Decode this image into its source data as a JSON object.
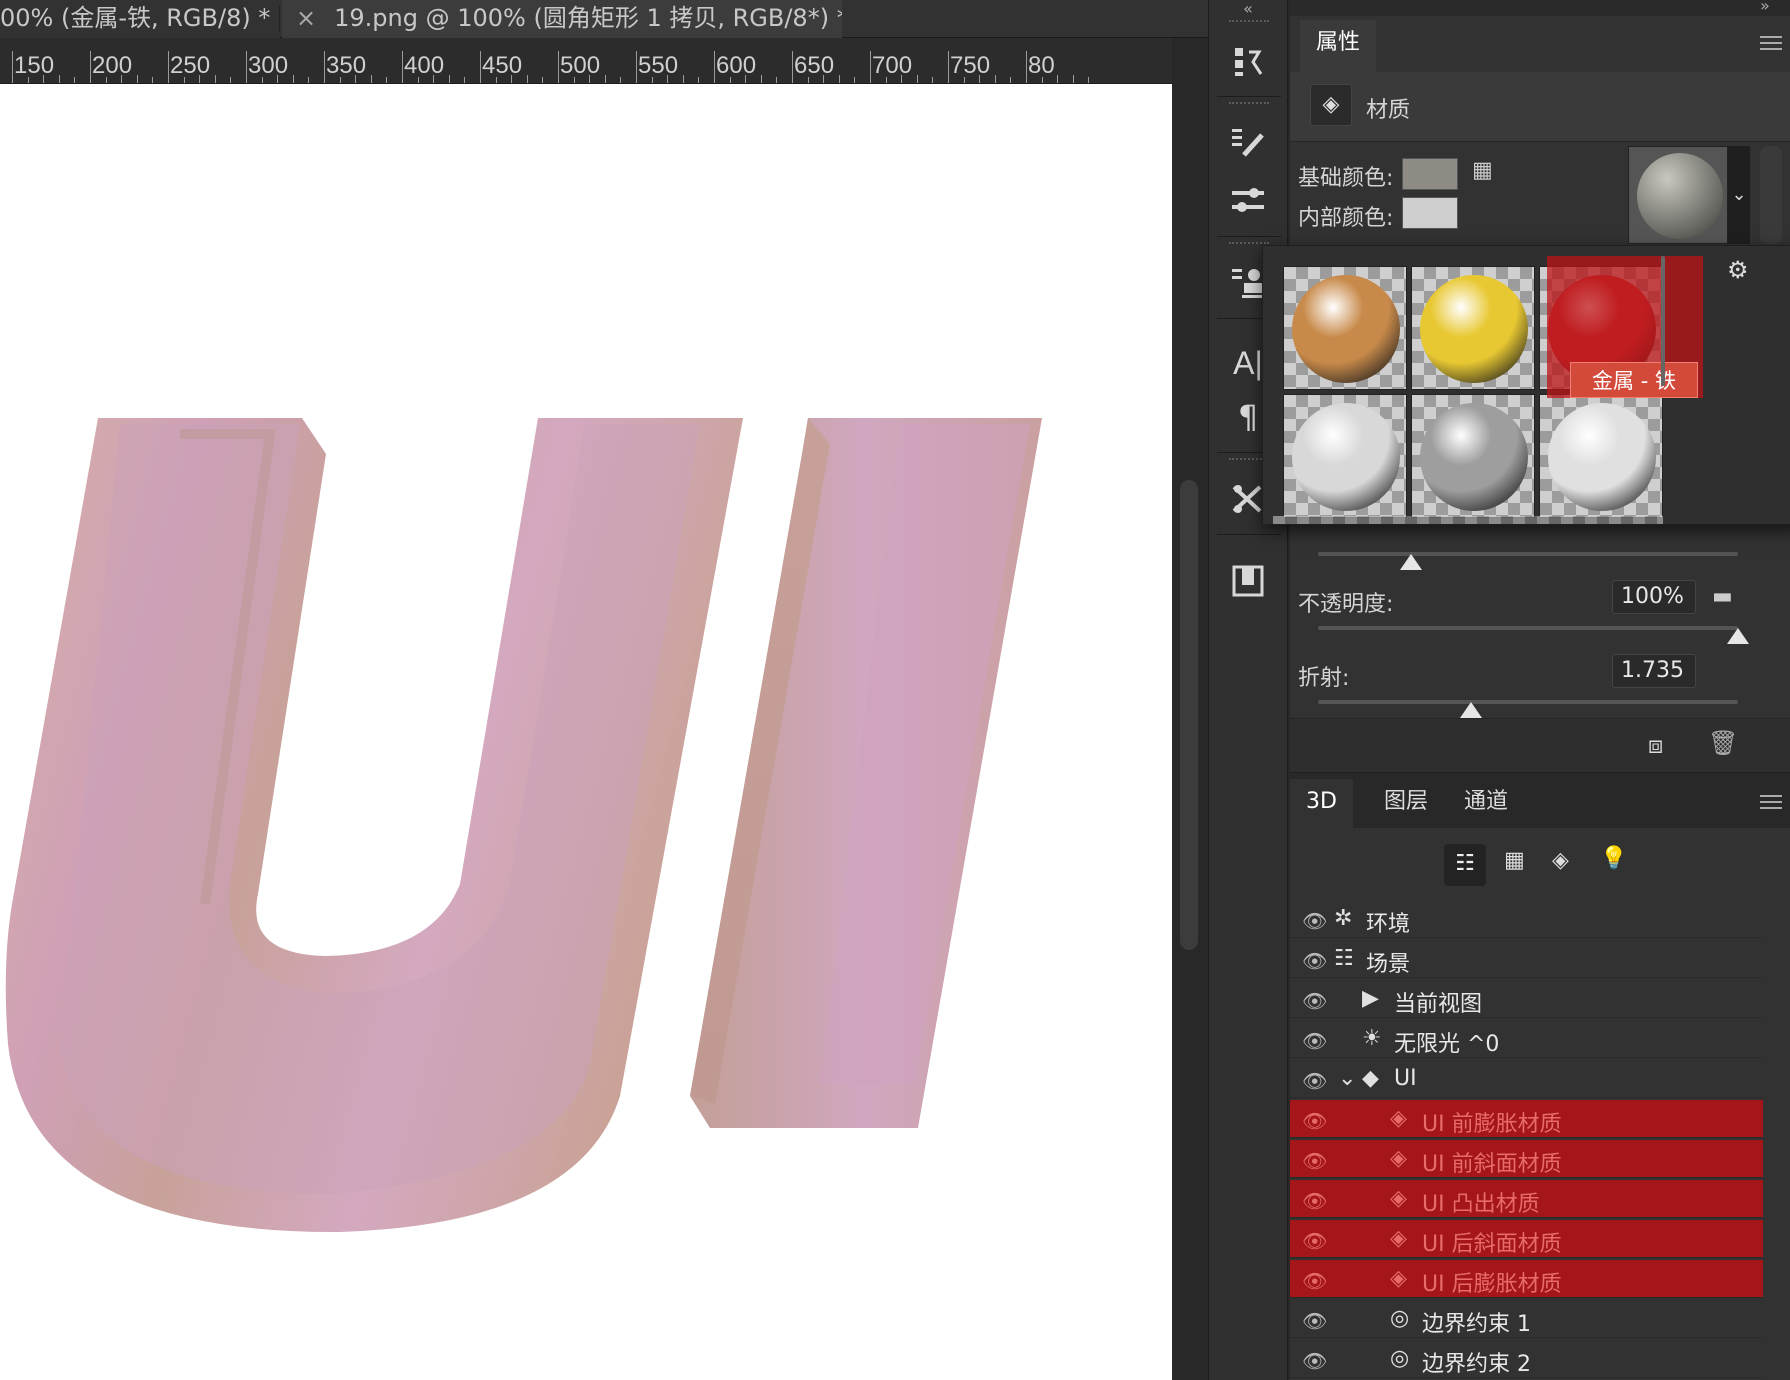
{
  "tabs": [
    {
      "label": "00% (金属-铁, RGB/8) *"
    },
    {
      "close": "×",
      "label": "19.png @ 100% (圆角矩形 1 拷贝, RGB/8*) *"
    }
  ],
  "ruler": {
    "labels": [
      "150",
      "200",
      "250",
      "300",
      "350",
      "400",
      "450",
      "500",
      "550",
      "600",
      "650",
      "700",
      "750",
      "80"
    ]
  },
  "properties": {
    "tab": "属性",
    "section_label": "材质",
    "base_color_label": "基础颜色:",
    "base_color": "#8d8b83",
    "inner_color_label": "内部颜色:",
    "inner_color": "#cfcfcf",
    "opacity_label": "不透明度:",
    "opacity_value": "100%",
    "refraction_label": "折射:",
    "refraction_value": "1.735",
    "slider_levels": {
      "hidden_slider": 0.22,
      "opacity": 1.0,
      "refraction": 0.36
    }
  },
  "material_picker": {
    "tooltip": "金属 - 铁",
    "items": [
      {
        "name": "copper",
        "color": "#c88a4a"
      },
      {
        "name": "gold",
        "color": "#e8c832"
      },
      {
        "name": "red",
        "color": "#c43a38"
      },
      {
        "name": "brushed-silver",
        "color": "#d8d8d8"
      },
      {
        "name": "steel",
        "color": "#9e9e9e"
      },
      {
        "name": "chrome",
        "color": "#e0e0e0"
      }
    ]
  },
  "layers_panel": {
    "tabs": [
      "3D",
      "图层",
      "通道"
    ],
    "rows": [
      {
        "label": "环境",
        "icon": "environment-icon",
        "selected": false
      },
      {
        "label": "场景",
        "icon": "scene-icon",
        "selected": false
      },
      {
        "label": "当前视图",
        "icon": "camera-icon",
        "selected": false
      },
      {
        "label": "无限光 ^0",
        "icon": "light-icon",
        "selected": false
      },
      {
        "label": "UI",
        "icon": "mesh-icon",
        "selected": false
      },
      {
        "label": "UI 前膨胀材质",
        "icon": "material-icon",
        "selected": true
      },
      {
        "label": "UI 前斜面材质",
        "icon": "material-icon",
        "selected": true
      },
      {
        "label": "UI 凸出材质",
        "icon": "material-icon",
        "selected": true
      },
      {
        "label": "UI 后斜面材质",
        "icon": "material-icon",
        "selected": true
      },
      {
        "label": "UI 后膨胀材质",
        "icon": "material-icon",
        "selected": true
      },
      {
        "label": "边界约束 1",
        "icon": "constraint-icon",
        "selected": false
      },
      {
        "label": "边界约束 2",
        "icon": "constraint-icon",
        "selected": false
      }
    ]
  },
  "canvas": {
    "text": "UI"
  },
  "colors": {
    "selection": "#a4161a",
    "accent_text": "#e86a6a"
  }
}
